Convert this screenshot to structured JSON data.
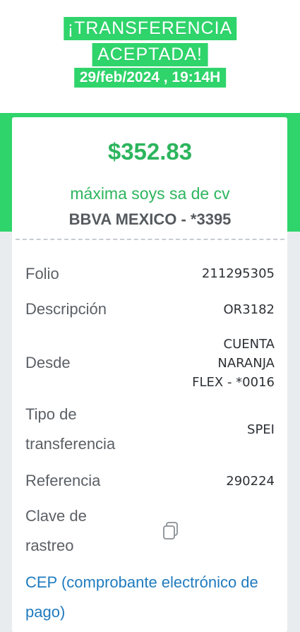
{
  "header": {
    "line1": "¡TRANSFERENCIA",
    "line2": "ACEPTADA!",
    "datetime": "29/feb/2024 , 19:14H"
  },
  "summary": {
    "amount": "$352.83",
    "beneficiary": "máxima soys sa de cv",
    "bank_account": "BBVA MEXICO - *3395"
  },
  "details": [
    {
      "label": "Folio",
      "value": "211295305"
    },
    {
      "label": "Descripción",
      "value": "OR3182"
    },
    {
      "label": "Desde",
      "value_lines": [
        "CUENTA",
        "NARANJA",
        "FLEX - *0016"
      ]
    },
    {
      "label_lines": [
        "Tipo de",
        "transferencia"
      ],
      "value": "SPEI"
    },
    {
      "label": "Referencia",
      "value": "290224"
    },
    {
      "label_lines": [
        "Clave de",
        "rastreo"
      ],
      "value_icon": "copy-icon"
    }
  ],
  "cep_link": "CEP (comprobante electrónico de pago)",
  "colors": {
    "accent": "#2fd46b",
    "amount_text": "#2db55d",
    "link": "#1f7bbf",
    "background_gray": "#e9ecef"
  }
}
